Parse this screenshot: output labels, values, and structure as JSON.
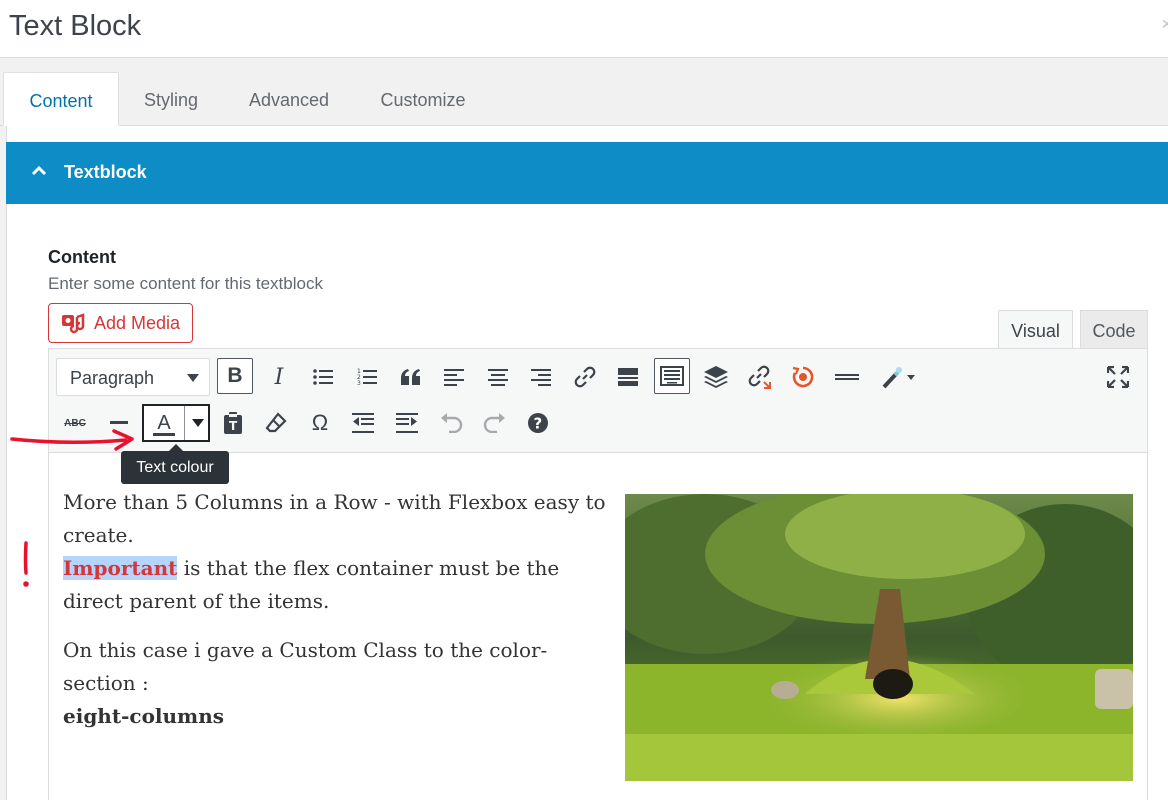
{
  "window": {
    "title": "Text Block",
    "close_glyph": "×"
  },
  "tabs": [
    {
      "label": "Content",
      "active": true
    },
    {
      "label": "Styling",
      "active": false
    },
    {
      "label": "Advanced",
      "active": false
    },
    {
      "label": "Customize",
      "active": false
    }
  ],
  "section": {
    "title": "Textblock",
    "icon": "chevron-up-icon",
    "color": "#0d8cc6"
  },
  "field": {
    "label": "Content",
    "description": "Enter some content for this textblock"
  },
  "add_media": {
    "label": "Add Media",
    "icon": "add-media-icon",
    "color": "#d63638"
  },
  "editor_modes": {
    "visual": "Visual",
    "code": "Code",
    "active": "visual"
  },
  "toolbar": {
    "format_value": "Paragraph",
    "row1_icons": [
      "bold-icon",
      "italic-icon",
      "bullet-list-icon",
      "numbered-list-icon",
      "blockquote-icon",
      "align-left-icon",
      "align-center-icon",
      "align-right-icon",
      "link-icon",
      "read-more-icon",
      "toolbar-toggle-icon",
      "layers-icon",
      "unlink-icon",
      "shortcode-icon",
      "horizontal-line-icon",
      "magic-wand-icon",
      "fullscreen-icon"
    ],
    "row2_icons": [
      "strikethrough-icon",
      "horizontal-rule-icon",
      "text-colour-icon",
      "paste-text-icon",
      "clear-formatting-icon",
      "special-character-icon",
      "outdent-icon",
      "indent-icon",
      "undo-icon",
      "redo-icon",
      "help-icon"
    ],
    "bold_glyph": "B",
    "italic_glyph": "I",
    "strike_glyph": "ABC",
    "omega_glyph": "Ω",
    "help_glyph": "?",
    "text_colour_glyph": "A",
    "tooltip": "Text colour"
  },
  "content": {
    "line1": "More than 5 Columns in a Row - with Flexbox easy to create.",
    "important": "Important",
    "line2_rest": " is that the flex container must be the direct parent of the items.",
    "line3": "On this case i gave a Custom Class to the color-section :",
    "class_name": "eight-columns",
    "important_color": "#d63638",
    "selection_color": "#b4d5fe"
  },
  "annotations": {
    "arrow_color": "#e8122f",
    "bang": "!"
  }
}
